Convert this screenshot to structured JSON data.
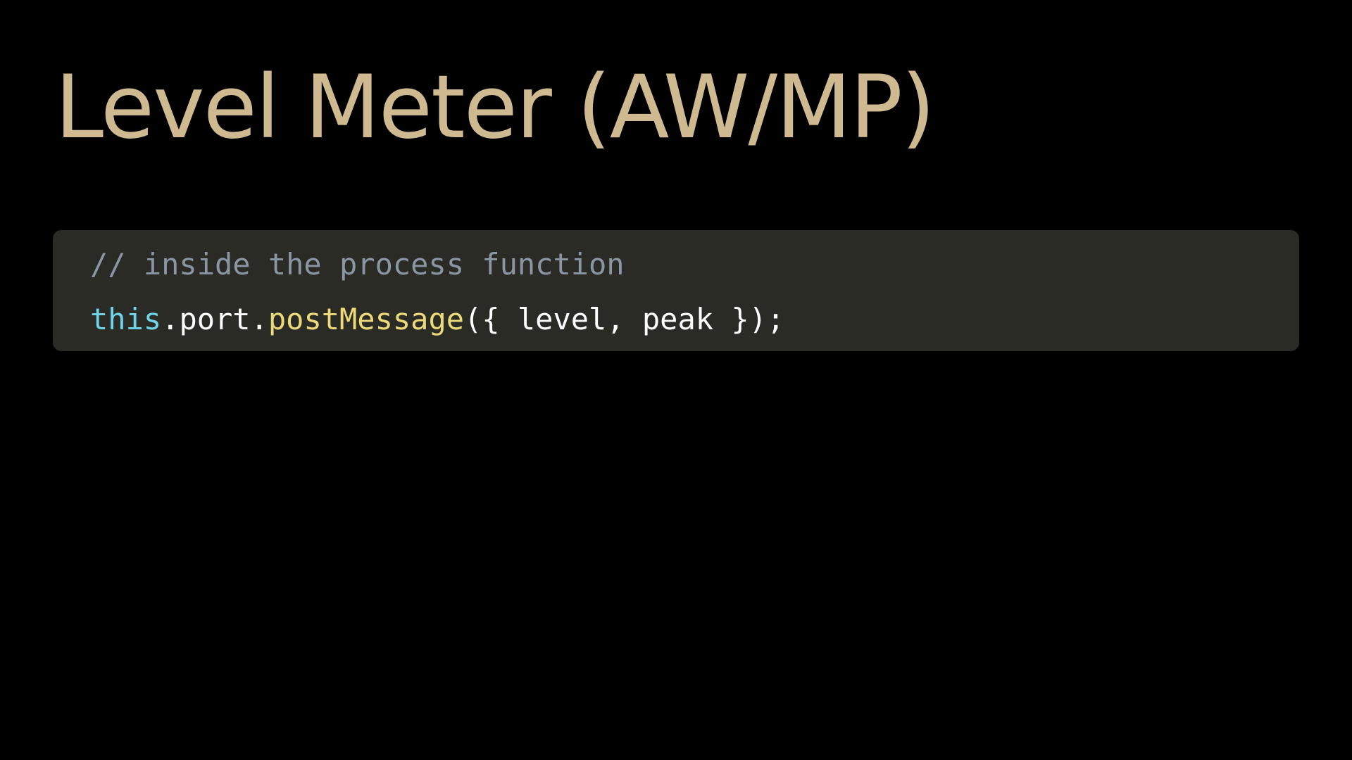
{
  "slide": {
    "title": "Level Meter (AW/MP)",
    "code": {
      "lines": [
        [
          {
            "kind": "comment",
            "text": "// inside the process function"
          }
        ],
        [
          {
            "kind": "keyword",
            "text": "this"
          },
          {
            "kind": "plain",
            "text": ".port."
          },
          {
            "kind": "func",
            "text": "postMessage"
          },
          {
            "kind": "plain",
            "text": "({ level, peak });"
          }
        ]
      ]
    }
  },
  "colors": {
    "background": "#000000",
    "title": "#cfb990",
    "code_background": "#2a2b25",
    "comment": "#8a96a3",
    "keyword": "#6fd3ea",
    "plain": "#ffffff",
    "function": "#ecd97a"
  }
}
